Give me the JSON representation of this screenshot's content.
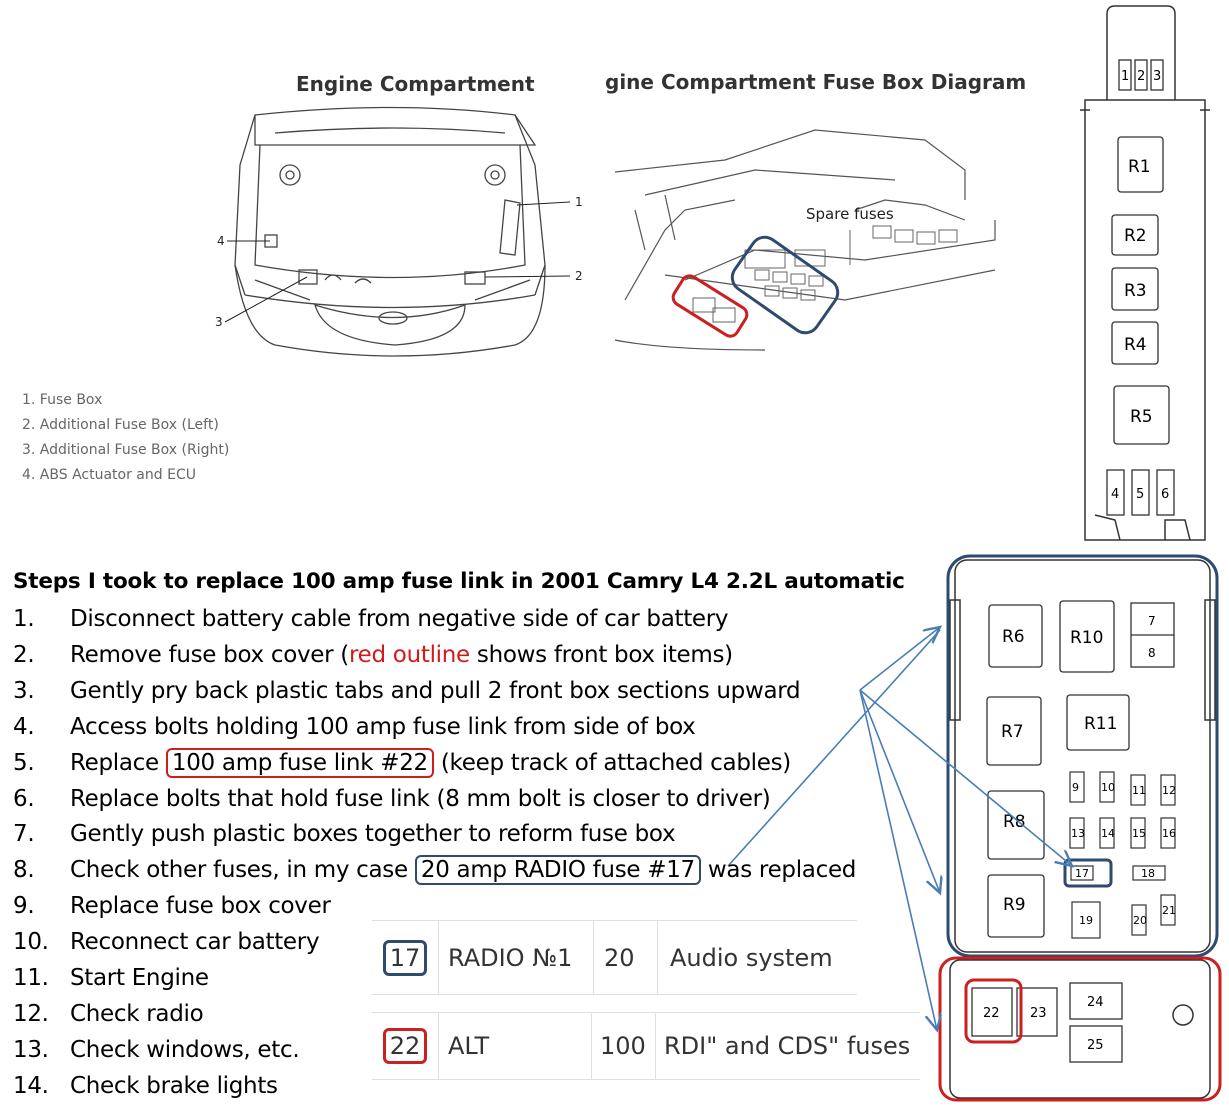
{
  "titles": {
    "engine_compartment": "Engine Compartment",
    "fuse_box_diagram": "gine Compartment Fuse Box Diagram"
  },
  "engine_callouts": [
    "1",
    "2",
    "3",
    "4"
  ],
  "legend": [
    "1. Fuse Box",
    "2. Additional Fuse Box (Left)",
    "3. Additional Fuse Box (Right)",
    "4. ABS Actuator and ECU"
  ],
  "spare_fuses_label": "Spare fuses",
  "heading": "Steps I took to replace 100 amp fuse link in 2001 Camry L4 2.2L automatic",
  "steps": [
    {
      "n": "1.",
      "text": "Disconnect battery cable from negative side of car battery"
    },
    {
      "n": "2.",
      "pre": "Remove fuse box cover (",
      "red": "red outline",
      "post": " shows front box items)"
    },
    {
      "n": "3.",
      "text": "Gently pry back plastic tabs and pull 2 front box sections upward"
    },
    {
      "n": "4.",
      "text": "Access bolts holding 100 amp fuse link from side of box"
    },
    {
      "n": "5.",
      "pre": "Replace ",
      "boxed": "100 amp fuse link #22",
      "post": "  (keep track of attached cables)"
    },
    {
      "n": "6.",
      "text": "Replace bolts that hold fuse link (8 mm bolt is closer to driver)"
    },
    {
      "n": "7.",
      "text": "Gently push plastic boxes together to reform fuse box"
    },
    {
      "n": "8.",
      "pre": "Check other fuses, in my case ",
      "boxed": "20 amp RADIO fuse #17",
      "post": " was replaced"
    },
    {
      "n": "9.",
      "text": "Replace fuse box cover"
    },
    {
      "n": "10.",
      "text": "Reconnect car battery"
    },
    {
      "n": "11.",
      "text": "Start Engine"
    },
    {
      "n": "12.",
      "text": "Check radio"
    },
    {
      "n": "13.",
      "text": "Check windows, etc."
    },
    {
      "n": "14.",
      "text": "Check brake lights"
    }
  ],
  "fuse_table": [
    {
      "num": "17",
      "name": "RADIO №1",
      "amp": "20",
      "desc": "Audio system",
      "highlight": "#2e4a6f"
    },
    {
      "num": "22",
      "name": "ALT",
      "amp": "100",
      "desc": "RDI\" and CDS\" fuses",
      "highlight": "#cc1f1f"
    }
  ],
  "fuse_box": {
    "top_fuses": [
      "1",
      "2",
      "3"
    ],
    "upper_relays": [
      "R1",
      "R2",
      "R3",
      "R4",
      "R5"
    ],
    "mid_fuses": [
      "4",
      "5",
      "6"
    ],
    "main_relays": [
      "R6",
      "R10",
      "R7",
      "R11",
      "R8",
      "R9"
    ],
    "small_fuses": [
      "7",
      "8",
      "9",
      "10",
      "11",
      "12",
      "13",
      "14",
      "15",
      "16",
      "17",
      "18",
      "19",
      "20",
      "21"
    ],
    "front_fuses": [
      "22",
      "23",
      "24",
      "25"
    ]
  },
  "colors": {
    "red_outline": "#cc1f1f",
    "blue_outline": "#2e4a6f",
    "arrow": "#4a7db5"
  }
}
